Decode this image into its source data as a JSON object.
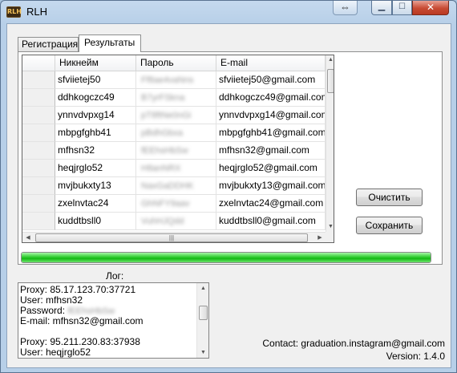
{
  "window": {
    "title": "RLH",
    "app_icon": "rlh-app-icon"
  },
  "tabs": [
    {
      "label": "Регистрация",
      "selected": false
    },
    {
      "label": "Результаты",
      "selected": true
    }
  ],
  "grid": {
    "columns": [
      "",
      "Никнейм",
      "Пароль",
      "E-mail"
    ],
    "rows": [
      {
        "nickname": "sfviietej50",
        "password": "Ff8ae4vaNns",
        "email": "sfviietej50@gmail.com"
      },
      {
        "nickname": "ddhkogczc49",
        "password": "B7yrFSkna",
        "email": "ddhkogczc49@gmail.com"
      },
      {
        "nickname": "ynnvdvpxg14",
        "password": "pT8ftNe0nGi",
        "email": "ynnvdvpxg14@gmail.com"
      },
      {
        "nickname": "mbpgfghb41",
        "password": "pBdhGbxa",
        "email": "mbpgfghb41@gmail.com"
      },
      {
        "nickname": "mfhsn32",
        "password": "fEEhsHbSw",
        "email": "mfhsn32@gmail.com"
      },
      {
        "nickname": "heqjrglo52",
        "password": "H8anNRX",
        "email": "heqjrglo52@gmail.com"
      },
      {
        "nickname": "mvjbukxty13",
        "password": "NaxGaDDHK",
        "email": "mvjbukxty13@gmail.com"
      },
      {
        "nickname": "zxelnvtac24",
        "password": "GhNFY9aav",
        "email": "zxelnvtac24@gmail.com"
      },
      {
        "nickname": "kuddtbsll0",
        "password": "VuhHJQdd",
        "email": "kuddtbsll0@gmail.com"
      }
    ]
  },
  "buttons": {
    "clear": "Очистить",
    "save": "Сохранить"
  },
  "progress": {
    "value": 1.0
  },
  "log": {
    "label": "Лог:",
    "lines": [
      "Proxy: 85.17.123.70:37721",
      "User: mfhsn32",
      "Password: fEEhsHbSw",
      "E-mail: mfhsn32@gmail.com",
      "",
      "Proxy: 95.211.230.83:37938",
      "User: heqjrglo52"
    ]
  },
  "footer": {
    "contact": "Contact: graduation.instagram@gmail.com",
    "version": "Version: 1.4.0"
  },
  "colors": {
    "progress_green": "#14b814",
    "close_button": "#c74a33"
  }
}
